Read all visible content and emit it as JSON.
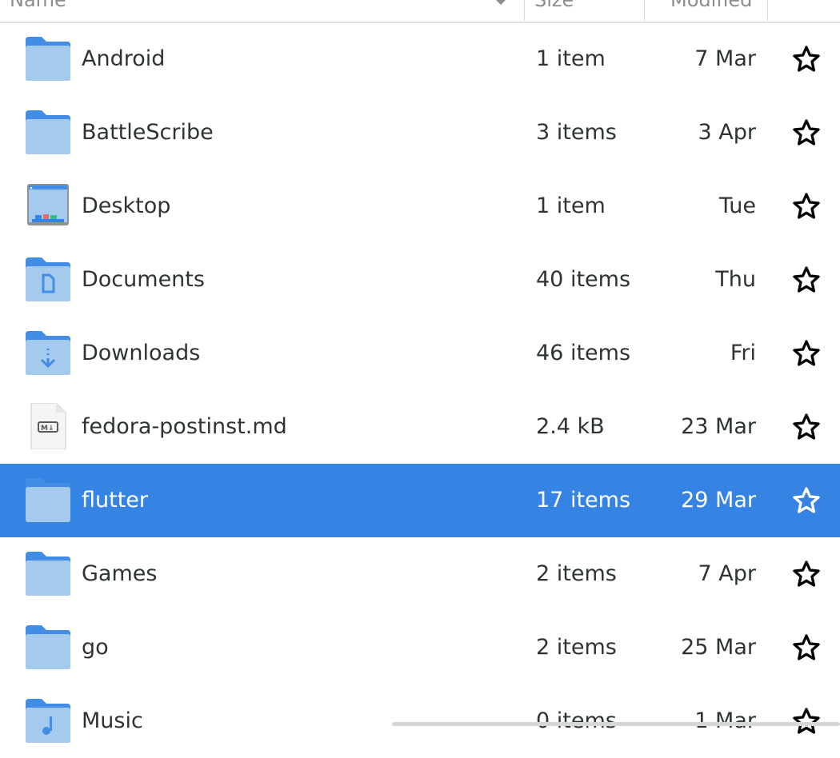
{
  "header": {
    "name": "Name",
    "size": "Size",
    "modified": "Modified"
  },
  "files": [
    {
      "name": "Android",
      "size": "1 item",
      "modified": "7 Mar",
      "icon": "folder-icon"
    },
    {
      "name": "BattleScribe",
      "size": "3 items",
      "modified": "3 Apr",
      "icon": "folder-icon"
    },
    {
      "name": "Desktop",
      "size": "1 item",
      "modified": "Tue",
      "icon": "desktop-folder-icon"
    },
    {
      "name": "Documents",
      "size": "40 items",
      "modified": "Thu",
      "icon": "documents-folder-icon"
    },
    {
      "name": "Downloads",
      "size": "46 items",
      "modified": "Fri",
      "icon": "downloads-folder-icon"
    },
    {
      "name": "fedora-postinst.md",
      "size": "2.4 kB",
      "modified": "23 Mar",
      "icon": "markdown-file-icon"
    },
    {
      "name": "flutter",
      "size": "17 items",
      "modified": "29 Mar",
      "icon": "folder-icon",
      "selected": true
    },
    {
      "name": "Games",
      "size": "2 items",
      "modified": "7 Apr",
      "icon": "folder-icon"
    },
    {
      "name": "go",
      "size": "2 items",
      "modified": "25 Mar",
      "icon": "folder-icon"
    },
    {
      "name": "Music",
      "size": "0 items",
      "modified": "1 Mar",
      "icon": "music-folder-icon"
    }
  ],
  "colors": {
    "selection": "#3584e4",
    "folder": "#a4caee",
    "folder_tab": "#438de6"
  }
}
